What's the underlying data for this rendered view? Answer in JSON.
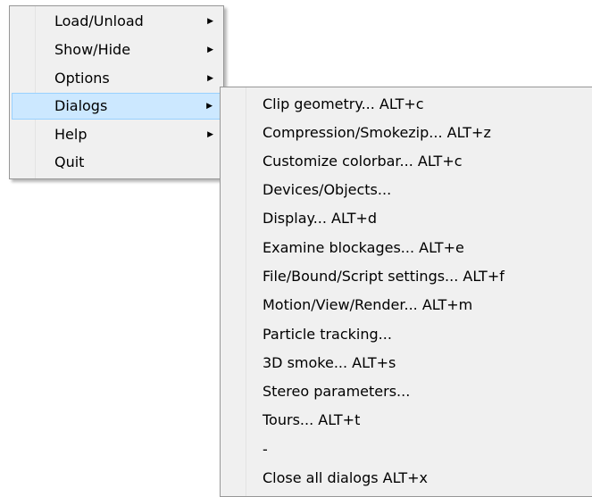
{
  "main_menu": {
    "items": [
      {
        "label": "Load/Unload",
        "submenu": true
      },
      {
        "label": "Show/Hide",
        "submenu": true
      },
      {
        "label": "Options",
        "submenu": true
      },
      {
        "label": "Dialogs",
        "submenu": true
      },
      {
        "label": "Help",
        "submenu": true
      },
      {
        "label": "Quit",
        "submenu": false
      }
    ],
    "highlighted_index": 3,
    "submenu_arrow_icon": "triangle-right-icon",
    "highlight_color": "#cce8ff"
  },
  "dialogs_menu": {
    "items": [
      {
        "label": "Clip geometry...  ALT+c"
      },
      {
        "label": "Compression/Smokezip...  ALT+z"
      },
      {
        "label": "Customize colorbar...  ALT+c"
      },
      {
        "label": "Devices/Objects..."
      },
      {
        "label": "Display...  ALT+d"
      },
      {
        "label": "Examine blockages...  ALT+e"
      },
      {
        "label": "File/Bound/Script settings...  ALT+f"
      },
      {
        "label": "Motion/View/Render...  ALT+m"
      },
      {
        "label": "Particle tracking..."
      },
      {
        "label": "3D smoke...  ALT+s"
      },
      {
        "label": "Stereo parameters..."
      },
      {
        "label": "Tours...  ALT+t"
      },
      {
        "label": "-"
      },
      {
        "label": "Close all dialogs  ALT+x"
      }
    ]
  }
}
